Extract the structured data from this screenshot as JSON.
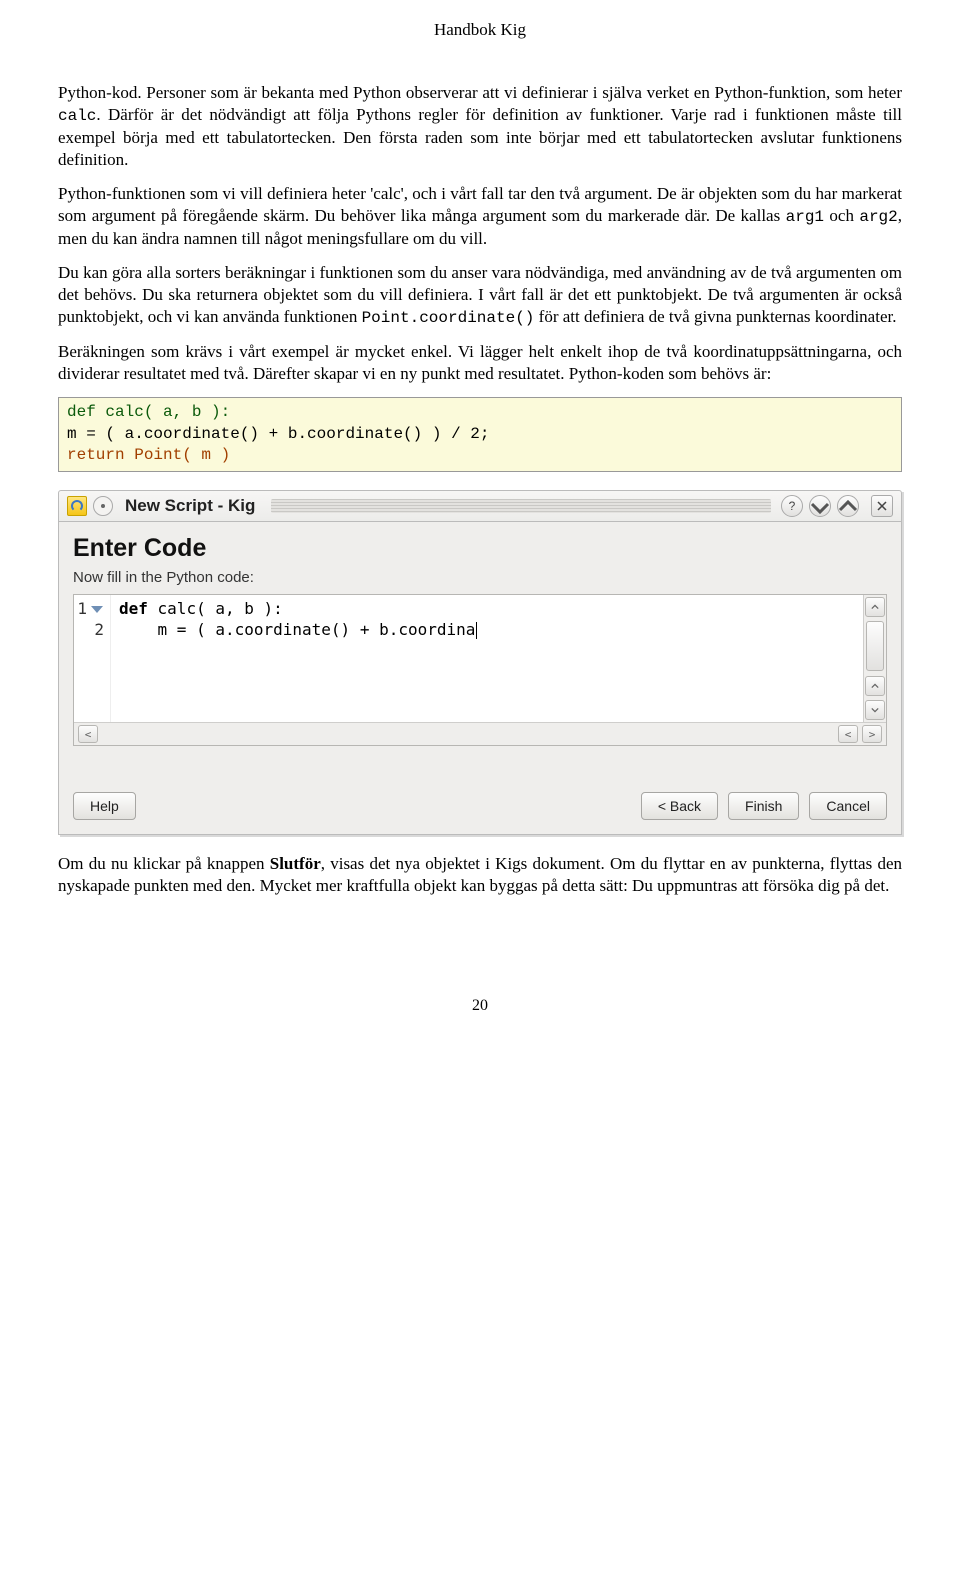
{
  "header": "Handbok Kig",
  "p1a": "Python-kod. Personer som är bekanta med Python observerar att vi definierar i själva verket en Python-funktion, som heter ",
  "p1_calc": "calc",
  "p1b": ". Därför är det nödvändigt att följa Pythons regler för definition av funktioner. Varje rad i funktionen måste till exempel börja med ett tabulatortecken. Den första raden som inte börjar med ett tabulatortecken avslutar funktionens definition.",
  "p2a": "Python-funktionen som vi vill definiera heter 'calc', och i vårt fall tar den två argument. De är objekten som du har markerat som argument på föregående skärm. Du behöver lika många argument som du markerade där. De kallas ",
  "p2_arg1": "arg1",
  "p2_mid": " och ",
  "p2_arg2": "arg2",
  "p2b": ", men du kan ändra namnen till något meningsfullare om du vill.",
  "p3a": "Du kan göra alla sorters beräkningar i funktionen som du anser vara nödvändiga, med användning av de två argumenten om det behövs. Du ska returnera objektet som du vill definiera. I vårt fall är det ett punktobjekt. De två argumenten är också punktobjekt, och vi kan använda funktionen ",
  "p3_code": "Point.coordinate()",
  "p3b": " för att definiera de två givna punkternas koordinater.",
  "p4": "Beräkningen som krävs i vårt exempel är mycket enkel. Vi lägger helt enkelt ihop de två koordinatuppsättningarna, och dividerar resultatet med två. Därefter skapar vi en ny punkt med resultatet. Python-koden som behövs är:",
  "code": {
    "l1": "def calc( a, b ):",
    "l2": "m = ( a.coordinate() + b.coordinate() ) / 2;",
    "l3": "return Point( m )"
  },
  "dialog": {
    "title": "New Script - Kig",
    "heading": "Enter Code",
    "sub": "Now fill in the Python code:",
    "gutter": [
      "1",
      "2"
    ],
    "line1_kw": "def",
    "line1_rest": " calc( a, b ):",
    "line2": "    m = ( a.coordinate() + b.coordina",
    "help": "Help",
    "back": "< Back",
    "finish": "Finish",
    "cancel": "Cancel"
  },
  "p5a": "Om du nu klickar på knappen ",
  "p5_bold": "Slutför",
  "p5b": ", visas det nya objektet i Kigs dokument. Om du flyttar en av punkterna, flyttas den nyskapade punkten med den. Mycket mer kraftfulla objekt kan byggas på detta sätt: Du uppmuntras att försöka dig på det.",
  "page_num": "20"
}
